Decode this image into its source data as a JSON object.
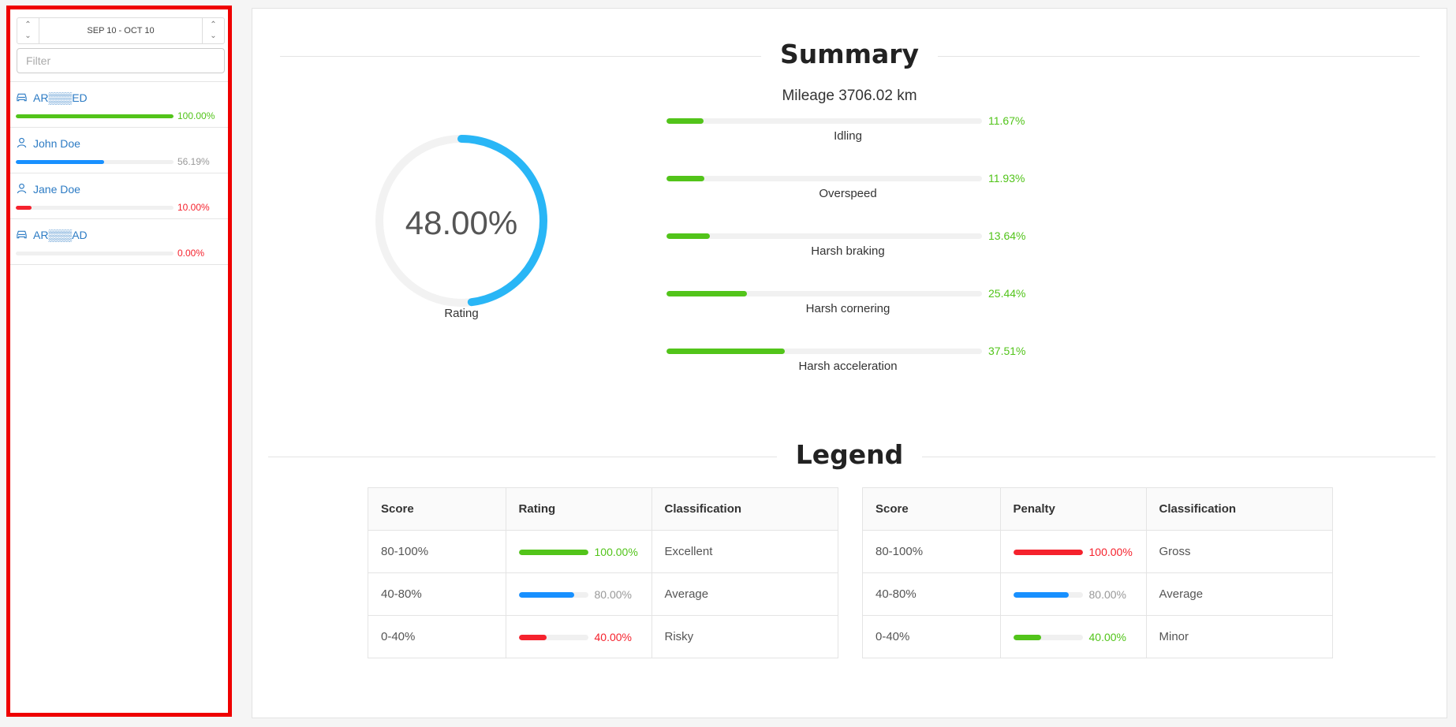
{
  "sidebar": {
    "date_range": "SEP 10 - OCT 10",
    "filter_placeholder": "Filter",
    "items": [
      {
        "name": "AR▒▒▒ED",
        "icon": "car-icon",
        "percent": 1.0,
        "percent_label": "100.00%",
        "color": "#52c41a"
      },
      {
        "name": "John Doe",
        "icon": "user-icon",
        "percent": 0.5619,
        "percent_label": "56.19%",
        "color": "#1890ff"
      },
      {
        "name": "Jane Doe",
        "icon": "user-icon",
        "percent": 0.1,
        "percent_label": "10.00%",
        "color": "#f5222d"
      },
      {
        "name": "AR▒▒▒AD",
        "icon": "car-icon",
        "percent": 0.0,
        "percent_label": "0.00%",
        "color": "#f5222d"
      }
    ]
  },
  "summary": {
    "title": "Summary",
    "mileage": "Mileage 3706.02 km",
    "rating_value": "48.00%",
    "rating_fraction": 0.48,
    "rating_label": "Rating",
    "metrics": [
      {
        "label": "Idling",
        "percent": 0.1167,
        "percent_label": "11.67%"
      },
      {
        "label": "Overspeed",
        "percent": 0.1193,
        "percent_label": "11.93%"
      },
      {
        "label": "Harsh braking",
        "percent": 0.1364,
        "percent_label": "13.64%"
      },
      {
        "label": "Harsh cornering",
        "percent": 0.2544,
        "percent_label": "25.44%"
      },
      {
        "label": "Harsh acceleration",
        "percent": 0.3751,
        "percent_label": "37.51%"
      }
    ]
  },
  "legend": {
    "title": "Legend",
    "rating_table": {
      "headers": [
        "Score",
        "Rating",
        "Classification"
      ],
      "rows": [
        {
          "score": "80-100%",
          "percent": 1.0,
          "percent_label": "100.00%",
          "color": "#52c41a",
          "classification": "Excellent"
        },
        {
          "score": "40-80%",
          "percent": 0.8,
          "percent_label": "80.00%",
          "color": "#1890ff",
          "classification": "Average"
        },
        {
          "score": "0-40%",
          "percent": 0.4,
          "percent_label": "40.00%",
          "color": "#f5222d",
          "classification": "Risky"
        }
      ]
    },
    "penalty_table": {
      "headers": [
        "Score",
        "Penalty",
        "Classification"
      ],
      "rows": [
        {
          "score": "80-100%",
          "percent": 1.0,
          "percent_label": "100.00%",
          "color": "#f5222d",
          "classification": "Gross"
        },
        {
          "score": "40-80%",
          "percent": 0.8,
          "percent_label": "80.00%",
          "color": "#1890ff",
          "classification": "Average"
        },
        {
          "score": "0-40%",
          "percent": 0.4,
          "percent_label": "40.00%",
          "color": "#52c41a",
          "classification": "Minor"
        }
      ]
    }
  },
  "colors": {
    "accent": "#29b6f6",
    "good": "#52c41a",
    "info": "#1890ff",
    "danger": "#f5222d",
    "muted": "#999999"
  }
}
